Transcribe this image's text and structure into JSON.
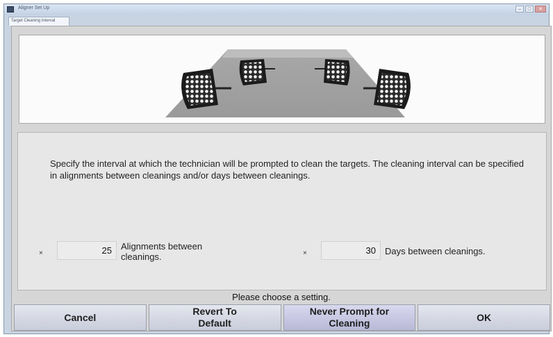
{
  "window": {
    "title": "Aligner Set Up",
    "controls": [
      "minimize",
      "maximize",
      "close"
    ]
  },
  "tabs": [
    {
      "label": "Target Cleaning Interval",
      "active": true
    }
  ],
  "description": "Specify the interval at which the technician will be prompted to clean the targets.  The cleaning interval can be specified in alignments between cleanings and/or days between cleanings.",
  "fields": {
    "alignments": {
      "marker": "×",
      "value": "25",
      "label": "Alignments between cleanings."
    },
    "days": {
      "marker": "×",
      "value": "30",
      "label": "Days between cleanings."
    }
  },
  "status": "Please choose a setting.",
  "buttons": {
    "cancel": "Cancel",
    "revert": "Revert To Default",
    "never": "Never Prompt for Cleaning",
    "ok": "OK"
  },
  "colors": {
    "window_frame": "#c9d4e2",
    "content_bg": "#d6d6d6",
    "panel_bg": "#e7e7e7",
    "button": "#d0d3e0"
  },
  "icons": {
    "app": "aligner-app-icon",
    "illustration": "wheel-targets-illustration"
  }
}
